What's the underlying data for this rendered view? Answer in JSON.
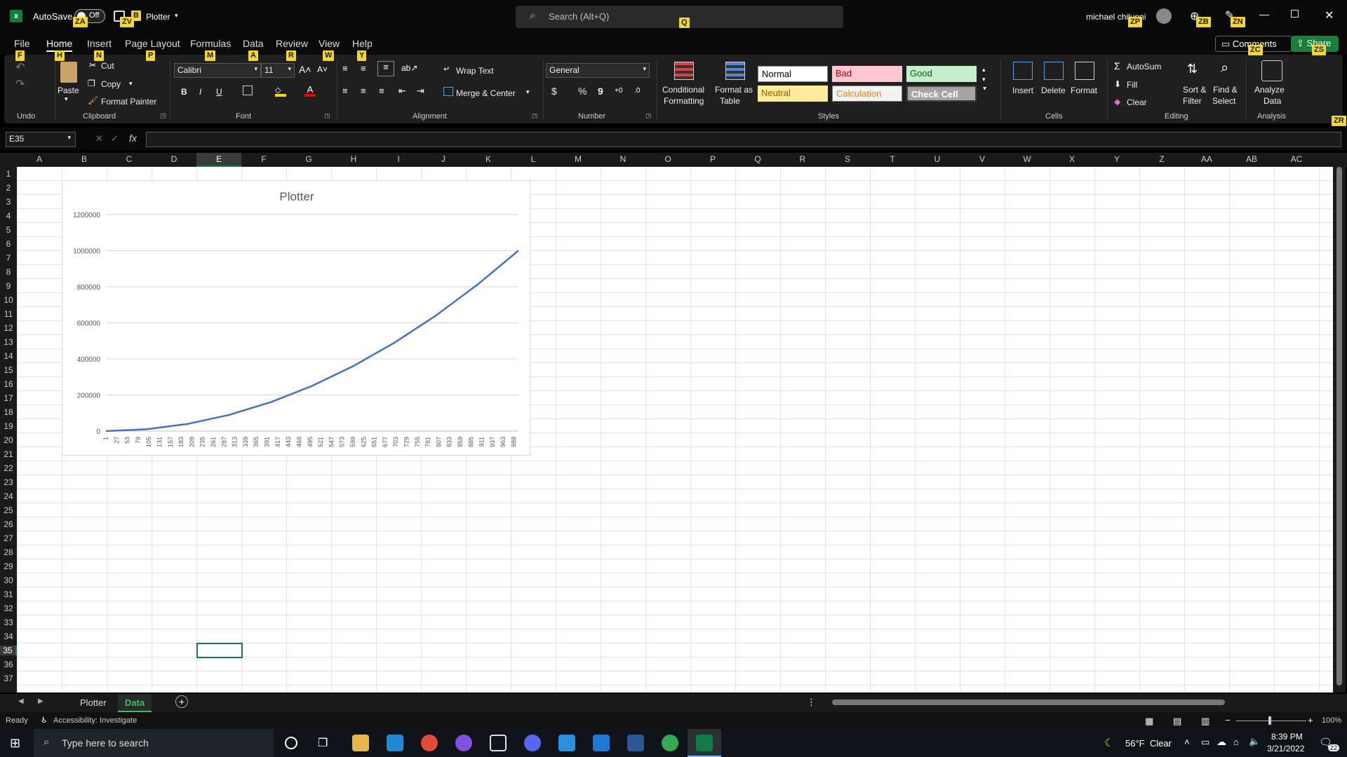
{
  "titlebar": {
    "autosave_label": "AutoSave",
    "autosave_state": "Off",
    "doc_name": "Plotter",
    "search_placeholder": "Search (Alt+Q)",
    "user": "michael chiluoni"
  },
  "keytips": {
    "za": "ZA",
    "zv": "ZV",
    "b": "B",
    "q": "Q",
    "zp": "ZP",
    "zb": "ZB",
    "zn": "ZN",
    "f": "F",
    "h": "H",
    "n": "N",
    "p": "P",
    "m": "M",
    "a": "A",
    "r": "R",
    "w": "W",
    "y": "Y",
    "zc": "ZC",
    "zs": "ZS",
    "zr": "ZR"
  },
  "menu": {
    "file": "File",
    "home": "Home",
    "insert": "Insert",
    "page_layout": "Page Layout",
    "formulas": "Formulas",
    "data": "Data",
    "review": "Review",
    "view": "View",
    "help": "Help",
    "comments": "Comments",
    "share": "Share"
  },
  "ribbon": {
    "undo_label": "Undo",
    "clipboard": {
      "paste": "Paste",
      "cut": "Cut",
      "copy": "Copy",
      "format_painter": "Format Painter",
      "label": "Clipboard"
    },
    "font": {
      "name": "Calibri",
      "size": "11",
      "bold": "B",
      "italic": "I",
      "underline": "U",
      "label": "Font"
    },
    "alignment": {
      "wrap": "Wrap Text",
      "merge": "Merge & Center",
      "label": "Alignment"
    },
    "number": {
      "format": "General",
      "currency": "$",
      "percent": "%",
      "comma": "9",
      "label": "Number"
    },
    "styles": {
      "cond1": "Conditional",
      "cond2": "Formatting",
      "fmt1": "Format as",
      "fmt2": "Table",
      "normal": "Normal",
      "bad": "Bad",
      "good": "Good",
      "neutral": "Neutral",
      "calculation": "Calculation",
      "check_cell": "Check Cell",
      "label": "Styles"
    },
    "cells": {
      "insert": "Insert",
      "delete": "Delete",
      "format": "Format",
      "label": "Cells"
    },
    "editing": {
      "autosum": "AutoSum",
      "fill": "Fill",
      "clear": "Clear",
      "sort1": "Sort &",
      "sort2": "Filter",
      "find1": "Find &",
      "find2": "Select",
      "label": "Editing"
    },
    "analysis": {
      "analyze1": "Analyze",
      "analyze2": "Data",
      "label": "Analysis"
    }
  },
  "formula_bar": {
    "name_box": "E35",
    "fx": "fx",
    "value": ""
  },
  "columns": [
    "A",
    "B",
    "C",
    "D",
    "E",
    "F",
    "G",
    "H",
    "I",
    "J",
    "K",
    "L",
    "M",
    "N",
    "O",
    "P",
    "Q",
    "R",
    "S",
    "T",
    "U",
    "V",
    "W",
    "X",
    "Y",
    "Z",
    "AA",
    "AB",
    "AC"
  ],
  "rows": [
    "1",
    "2",
    "3",
    "4",
    "5",
    "6",
    "7",
    "8",
    "9",
    "10",
    "11",
    "12",
    "13",
    "14",
    "15",
    "16",
    "17",
    "18",
    "19",
    "20",
    "21",
    "22",
    "23",
    "24",
    "25",
    "26",
    "27",
    "28",
    "29",
    "30",
    "31",
    "32",
    "33",
    "34",
    "35",
    "36",
    "37"
  ],
  "chart_data": {
    "type": "line",
    "title": "Plotter",
    "x_ticks": [
      "1",
      "27",
      "53",
      "79",
      "105",
      "131",
      "157",
      "183",
      "209",
      "235",
      "261",
      "287",
      "313",
      "339",
      "365",
      "391",
      "417",
      "443",
      "469",
      "495",
      "521",
      "547",
      "573",
      "599",
      "625",
      "651",
      "677",
      "703",
      "729",
      "755",
      "781",
      "807",
      "833",
      "859",
      "885",
      "911",
      "937",
      "963",
      "989"
    ],
    "y_ticks": [
      "0",
      "200000",
      "400000",
      "600000",
      "800000",
      "1000000",
      "1200000"
    ],
    "ylim": [
      0,
      1200000
    ],
    "xlim": [
      1,
      1000
    ],
    "series": [
      {
        "color": "#4472c4",
        "x": [
          1,
          100,
          200,
          300,
          400,
          500,
          600,
          700,
          800,
          900,
          1000
        ],
        "y": [
          1,
          10000,
          40000,
          90000,
          160000,
          250000,
          360000,
          490000,
          640000,
          810000,
          1000000
        ]
      }
    ],
    "grid": true
  },
  "sheets": {
    "tab1": "Plotter",
    "tab2": "Data",
    "active": "Data"
  },
  "status": {
    "ready": "Ready",
    "accessibility": "Accessibility: Investigate",
    "zoom": "100%"
  },
  "taskbar": {
    "search": "Type here to search",
    "weather": "56°F  Clear",
    "time": "8:39 PM",
    "date": "3/21/2022",
    "notif": "22"
  }
}
